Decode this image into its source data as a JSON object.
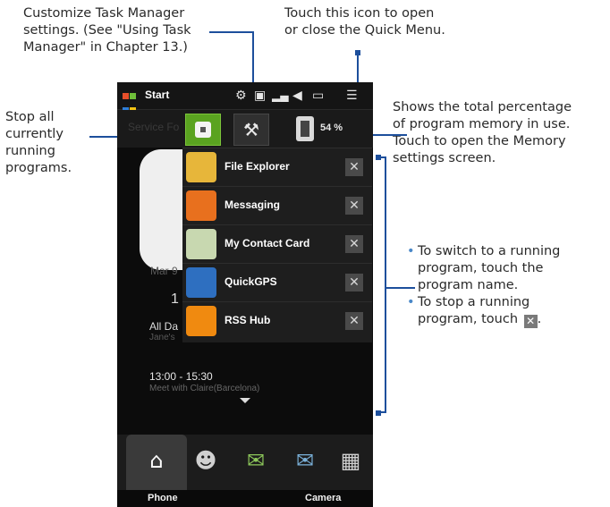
{
  "annotations": {
    "customize": [
      "Customize Task Manager",
      "settings. (See \"Using Task",
      "Manager\" in Chapter 13.)"
    ],
    "quick_menu": [
      "Touch this icon to open",
      "or close the Quick Menu."
    ],
    "stop_all": [
      "Stop all",
      "currently",
      "running",
      "programs."
    ],
    "memory": [
      "Shows the total percentage",
      "of program memory in use.",
      "Touch to open the Memory",
      "settings screen."
    ],
    "bullets": {
      "b1": [
        "To switch to a running",
        "program, touch the",
        "program name."
      ],
      "b2_lines": [
        "To stop a running",
        "program, touch"
      ]
    }
  },
  "phone": {
    "start_label": "Start",
    "tab_ghost_label": "Service Fo",
    "memory_percent": "54 %",
    "tasks": [
      {
        "label": "File Explorer",
        "color": "#e7b63a"
      },
      {
        "label": "Messaging",
        "color": "#e8701e"
      },
      {
        "label": "My Contact Card",
        "color": "#c8d8b0"
      },
      {
        "label": "QuickGPS",
        "color": "#2e6fc0"
      },
      {
        "label": "RSS Hub",
        "color": "#f08a10"
      }
    ],
    "close_glyph": "✕",
    "background_text": {
      "date": "Mar 9",
      "call": "1",
      "allday": "All Da",
      "jane": "Jane's"
    },
    "agenda": {
      "time": "13:00 - 15:30",
      "desc": "Meet with Claire(Barcelona)"
    },
    "softkeys": {
      "left": "Phone",
      "right": "Camera"
    },
    "dock_icons": [
      "home-icon",
      "contacts-icon",
      "messages-icon",
      "mail-icon",
      "calendar-icon"
    ]
  },
  "colors": {
    "callout": "#1d4f9c",
    "accent_green": "#5aa320"
  }
}
